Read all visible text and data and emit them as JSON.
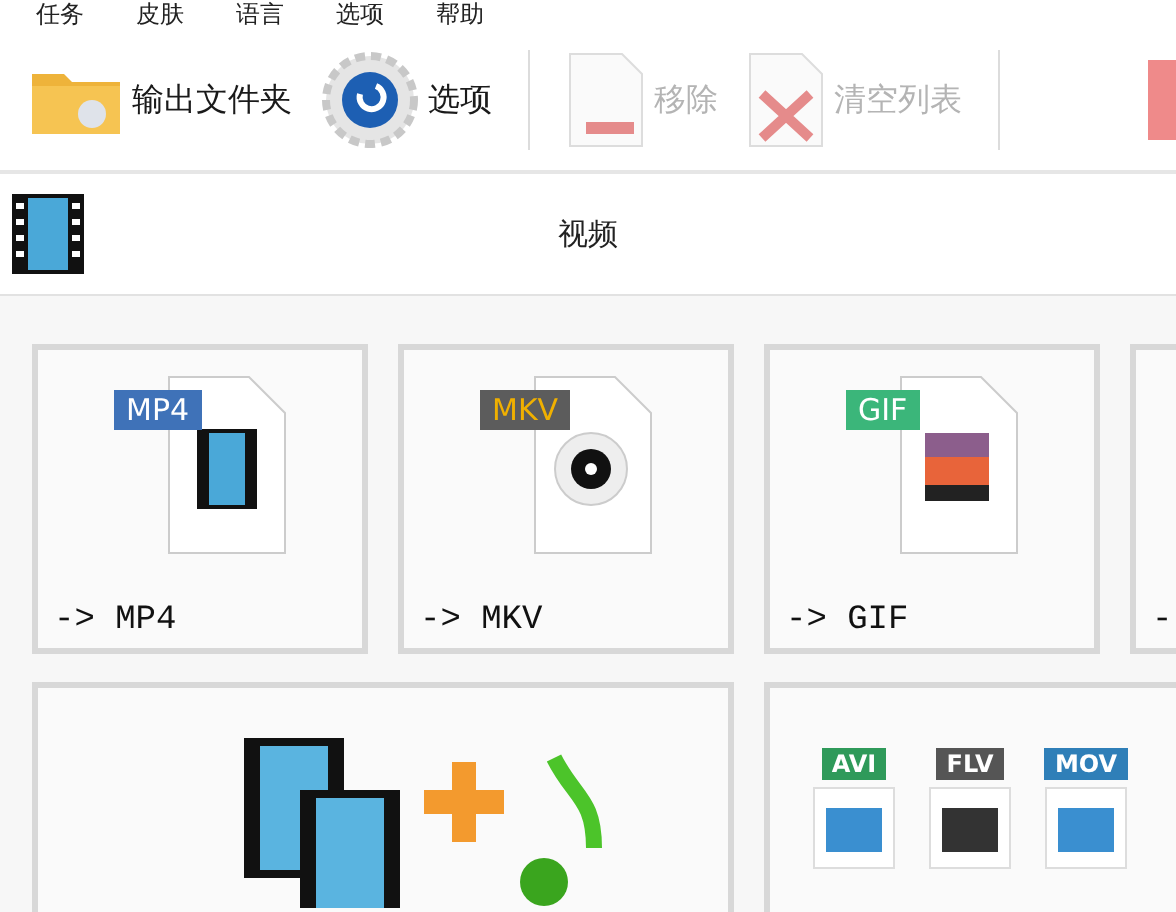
{
  "menu": [
    {
      "label": "任务"
    },
    {
      "label": "皮肤"
    },
    {
      "label": "语言"
    },
    {
      "label": "选项"
    },
    {
      "label": "帮助"
    }
  ],
  "toolbar": [
    {
      "label": "输出文件夹",
      "kind": "folder",
      "disabled": false
    },
    {
      "label": "选项",
      "kind": "gear",
      "disabled": false
    },
    {
      "kind": "divider"
    },
    {
      "label": "移除",
      "kind": "remove",
      "disabled": true
    },
    {
      "label": "清空列表",
      "kind": "clear",
      "disabled": true
    },
    {
      "kind": "divider"
    },
    {
      "kind": "partial"
    }
  ],
  "category": {
    "title": "视频"
  },
  "formats": [
    {
      "tag": "MP4",
      "color": "#3f72b8",
      "label": "-> MP4",
      "kind": "film"
    },
    {
      "tag": "MKV",
      "color": "#5c5c5c",
      "label": "-> MKV",
      "kind": "reel"
    },
    {
      "tag": "GIF",
      "color": "#3bb67a",
      "label": "-> GIF",
      "kind": "photo"
    },
    {
      "label": "-",
      "kind": "cut"
    }
  ],
  "tools": [
    {
      "kind": "join"
    },
    {
      "kind": "multi",
      "tags": [
        {
          "tag": "AVI",
          "color": "#2f9a5a"
        },
        {
          "tag": "FLV",
          "color": "#555555"
        },
        {
          "tag": "MOV",
          "color": "#2f7fb8"
        }
      ]
    }
  ]
}
